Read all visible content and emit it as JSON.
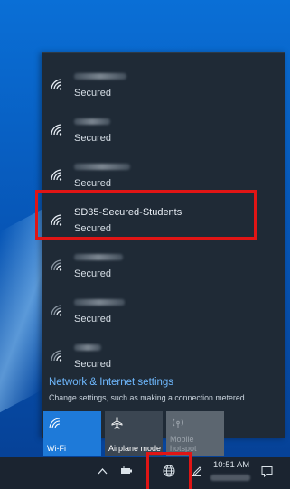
{
  "networks": [
    {
      "name": "",
      "status": "Secured"
    },
    {
      "name": "",
      "status": "Secured"
    },
    {
      "name": "",
      "status": "Secured"
    },
    {
      "name": "SD35-Secured-Students",
      "status": "Secured"
    },
    {
      "name": "",
      "status": "Secured"
    },
    {
      "name": "",
      "status": "Secured"
    },
    {
      "name": "",
      "status": "Secured"
    }
  ],
  "settings": {
    "title": "Network & Internet settings",
    "subtitle": "Change settings, such as making a connection metered."
  },
  "quick_actions": {
    "wifi": {
      "label": "Wi-Fi",
      "icon": "wifi-icon",
      "state": "on"
    },
    "airplane": {
      "label": "Airplane mode",
      "icon": "airplane-icon",
      "state": "off"
    },
    "mobile_hotspot": {
      "label": "Mobile hotspot",
      "icon": "mobile-hotspot-icon",
      "state": "disabled"
    }
  },
  "taskbar": {
    "time": "10:51 AM",
    "icons": [
      "chevron-up-icon",
      "battery-icon",
      "network-globe-icon",
      "pen-icon",
      "notification-icon"
    ]
  },
  "colors": {
    "accent": "#1e7ad9",
    "link": "#6fb9ff",
    "highlight": "#e01515"
  }
}
